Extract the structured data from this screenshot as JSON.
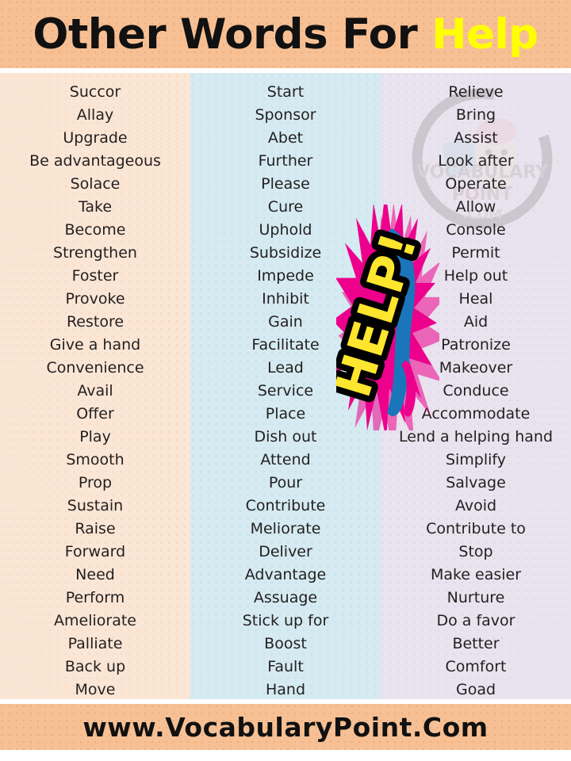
{
  "header": {
    "title_prefix": "Other Words For",
    "title_highlight": "Help",
    "background_color": "#f7c094",
    "highlight_color": "#ffff00"
  },
  "footer": {
    "website": "www.VocabularyPoint.Com",
    "background_color": "#f7c094"
  },
  "watermark": {
    "line1": "VOCABULARY",
    "line2": "POINT",
    "line3": ".COM"
  },
  "sticker": {
    "label": "HELP!",
    "text_color": "#ffe62e",
    "burst_color": "#ec008c",
    "accent_color": "#1b75bb",
    "outline_color": "#000000"
  },
  "columns": [
    {
      "name": "column-1",
      "background_color": "#fbe6d5",
      "words": [
        "Succor",
        "Allay",
        "Upgrade",
        "Be advantageous",
        "Solace",
        "Take",
        "Become",
        "Strengthen",
        "Foster",
        "Provoke",
        "Restore",
        "Give a hand",
        "Convenience",
        "Avail",
        "Offer",
        "Play",
        "Smooth",
        "Prop",
        "Sustain",
        "Raise",
        "Forward",
        "Need",
        "Perform",
        "Ameliorate",
        "Palliate",
        "Back up",
        "Move"
      ]
    },
    {
      "name": "column-2",
      "background_color": "#d5eaf1",
      "words": [
        "Start",
        "Sponsor",
        "Abet",
        "Further",
        "Please",
        "Cure",
        "Uphold",
        "Subsidize",
        "Impede",
        "Inhibit",
        "Gain",
        "Facilitate",
        "Lead",
        "Service",
        "Place",
        "Dish out",
        "Attend",
        "Pour",
        "Contribute",
        "Meliorate",
        "Deliver",
        "Advantage",
        "Assuage",
        "Stick up for",
        "Boost",
        "Fault",
        "Hand"
      ]
    },
    {
      "name": "column-3",
      "background_color": "#e8e3ee",
      "words": [
        "Relieve",
        "Bring",
        "Assist",
        "Look after",
        "Operate",
        "Allow",
        "Console",
        "Permit",
        "Help out",
        "Heal",
        "Aid",
        "Patronize",
        "Makeover",
        "Conduce",
        "Accommodate",
        "Lend a helping hand",
        "Simplify",
        "Salvage",
        "Avoid",
        "Contribute to",
        "Stop",
        "Make easier",
        "Nurture",
        "Do a favor",
        "Better",
        "Comfort",
        "Goad"
      ]
    }
  ]
}
